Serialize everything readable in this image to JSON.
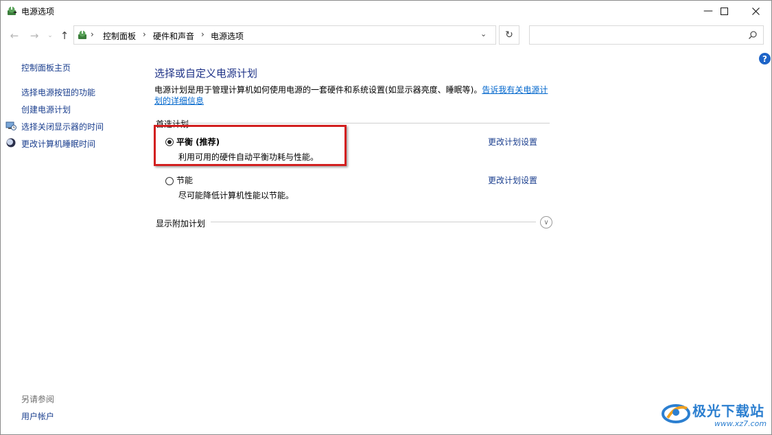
{
  "window": {
    "title": "电源选项"
  },
  "address_bar": {
    "crumbs": [
      "控制面板",
      "硬件和声音",
      "电源选项"
    ]
  },
  "search": {
    "placeholder": ""
  },
  "sidebar": {
    "home": "控制面板主页",
    "items": [
      {
        "label": "选择电源按钮的功能",
        "icon": ""
      },
      {
        "label": "创建电源计划",
        "icon": ""
      },
      {
        "label": "选择关闭显示器的时间",
        "icon": "monitor-clock-icon"
      },
      {
        "label": "更改计算机睡眠时间",
        "icon": "moon-icon"
      }
    ],
    "see_also_title": "另请参阅",
    "see_also_items": [
      "用户帐户"
    ]
  },
  "main": {
    "heading": "选择或自定义电源计划",
    "description": "电源计划是用于管理计算机如何使用电源的一套硬件和系统设置(如显示器亮度、睡眠等)。",
    "description_link_1": "告诉我有关电源计",
    "description_link_2": "划的详细信息",
    "group_label": "首选计划",
    "plans": [
      {
        "name": "平衡 (推荐)",
        "desc": "利用可用的硬件自动平衡功耗与性能。",
        "selected": true,
        "link": "更改计划设置"
      },
      {
        "name": "节能",
        "desc": "尽可能降低计算机性能以节能。",
        "selected": false,
        "link": "更改计划设置"
      }
    ],
    "more_plans": "显示附加计划"
  },
  "watermark": {
    "text": "极光下载站",
    "url": "www.xz7.com"
  },
  "colors": {
    "link": "#1a3e8e",
    "heading": "#1e3287",
    "highlight": "#d21f1f"
  }
}
